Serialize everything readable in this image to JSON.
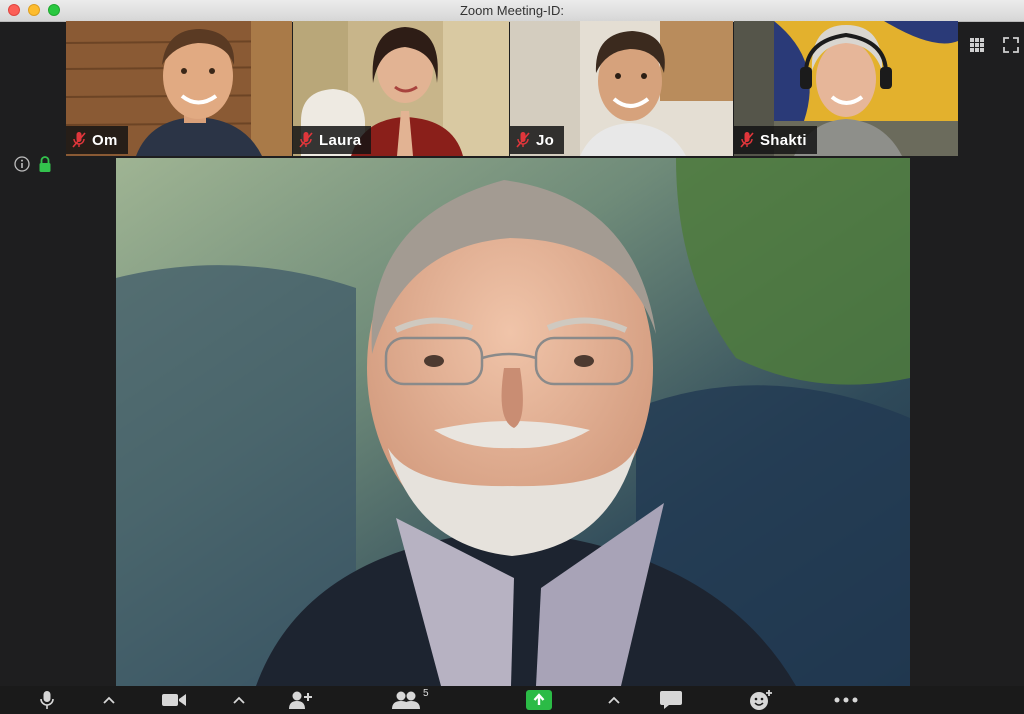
{
  "window": {
    "title": "Zoom Meeting-ID:"
  },
  "participants": [
    {
      "name": "Om",
      "muted": true
    },
    {
      "name": "Laura",
      "muted": true
    },
    {
      "name": "Jo",
      "muted": true
    },
    {
      "name": "Shakti",
      "muted": true
    }
  ],
  "toolbar": {
    "participant_count": "5"
  },
  "colors": {
    "share_green": "#2bbb46",
    "muted_red": "#e0363b",
    "toolbar_bg": "#1a1a1a"
  }
}
